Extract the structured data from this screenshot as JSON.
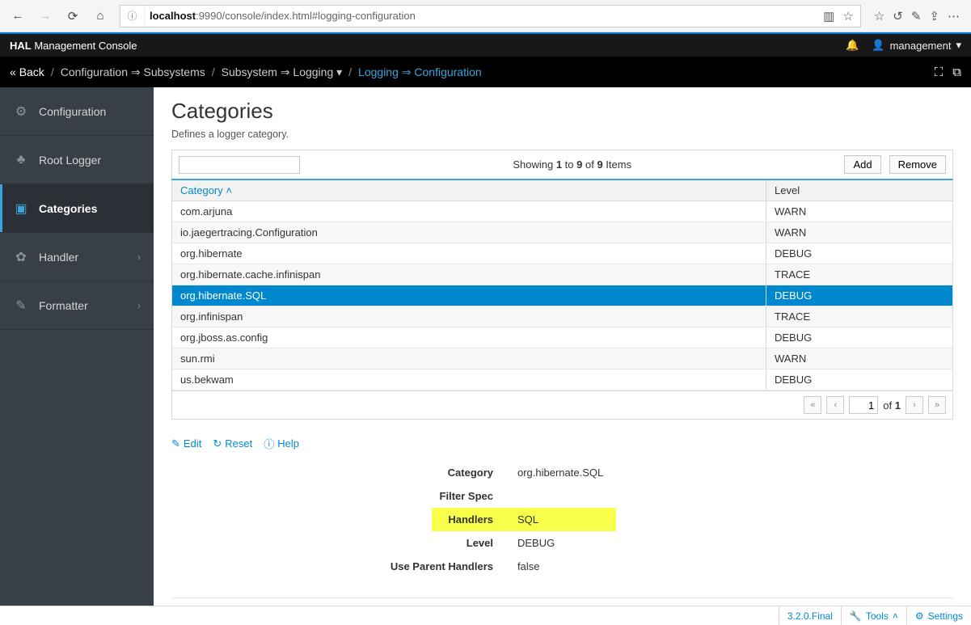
{
  "browser": {
    "url_prefix": "localhost",
    "url_rest": ":9990/console/index.html#logging-configuration"
  },
  "topbar": {
    "brand_bold": "HAL",
    "brand_rest": "Management Console",
    "user": "management"
  },
  "breadcrumb": {
    "back": "Back",
    "items": [
      {
        "label": "Configuration",
        "arrow": true
      },
      {
        "label": "Subsystems"
      },
      {
        "label": "Subsystem",
        "arrow": true
      },
      {
        "label": "Logging",
        "caret": true
      },
      {
        "blue_a": "Logging",
        "blue_arrow": true,
        "blue_b": "Configuration"
      }
    ]
  },
  "sidebar": {
    "items": [
      {
        "icon": "⚙",
        "label": "Configuration"
      },
      {
        "icon": "♣",
        "label": "Root Logger"
      },
      {
        "icon": "▣",
        "label": "Categories",
        "active": true
      },
      {
        "icon": "✿",
        "label": "Handler",
        "chevron": true
      },
      {
        "icon": "✎",
        "label": "Formatter",
        "chevron": true
      }
    ]
  },
  "page": {
    "title": "Categories",
    "subtitle": "Defines a logger category.",
    "showing_a": "Showing ",
    "showing_b1": "1",
    "showing_to": " to ",
    "showing_b2": "9",
    "showing_of": " of ",
    "showing_b3": "9",
    "showing_items": " Items",
    "add": "Add",
    "remove": "Remove",
    "col_category": "Category  ˄",
    "col_level": "Level",
    "rows": [
      {
        "cat": "com.arjuna",
        "lvl": "WARN"
      },
      {
        "cat": "io.jaegertracing.Configuration",
        "lvl": "WARN"
      },
      {
        "cat": "org.hibernate",
        "lvl": "DEBUG"
      },
      {
        "cat": "org.hibernate.cache.infinispan",
        "lvl": "TRACE"
      },
      {
        "cat": "org.hibernate.SQL",
        "lvl": "DEBUG",
        "selected": true
      },
      {
        "cat": "org.infinispan",
        "lvl": "TRACE"
      },
      {
        "cat": "org.jboss.as.config",
        "lvl": "DEBUG"
      },
      {
        "cat": "sun.rmi",
        "lvl": "WARN"
      },
      {
        "cat": "us.bekwam",
        "lvl": "DEBUG"
      }
    ],
    "page_input": "1",
    "page_of": "of",
    "page_total": "1"
  },
  "actions": {
    "edit": "Edit",
    "reset": "Reset",
    "help": "Help"
  },
  "details": {
    "category_label": "Category",
    "category_value": "org.hibernate.SQL",
    "filter_label": "Filter Spec",
    "filter_value": "",
    "handlers_label": "Handlers",
    "handlers_value": "SQL",
    "level_label": "Level",
    "level_value": "DEBUG",
    "uph_label": "Use Parent Handlers",
    "uph_value": "false"
  },
  "footer": {
    "version": "3.2.0.Final",
    "tools": "Tools",
    "settings": "Settings"
  }
}
